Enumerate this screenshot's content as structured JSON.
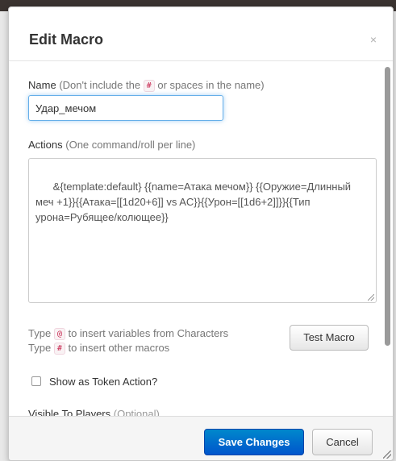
{
  "dialog": {
    "title": "Edit Macro",
    "close_glyph": "×"
  },
  "name_field": {
    "label": "Name",
    "hint_before": "(Don't include the",
    "hint_code": "#",
    "hint_after": "or spaces in the name)",
    "value": "Удар_мечом"
  },
  "actions_field": {
    "label": "Actions",
    "hint": "(One command/roll per line)",
    "value": "&{template:default} {{name=Атака мечом}} {{Оружие=Длинный меч +1}}{{Атака=[[1d20+6]] vs AC}}{{Урон=[[1d6+2]]}}{{Тип урона=Рубящее/колющее}}"
  },
  "help": {
    "line1_prefix": "Type",
    "line1_code": "@",
    "line1_suffix": "to insert variables from Characters",
    "line2_prefix": "Type",
    "line2_code": "#",
    "line2_suffix": "to insert other macros"
  },
  "buttons": {
    "test_macro": "Test Macro",
    "save_changes": "Save Changes",
    "cancel": "Cancel"
  },
  "token_action": {
    "label": "Show as Token Action?",
    "checked": false
  },
  "visible_to_players": {
    "label": "Visible To Players",
    "hint": "(Optional)"
  },
  "icons": {
    "close": "close-icon",
    "resize": "resize-grip-icon"
  },
  "colors": {
    "primary": "#0070cc",
    "code_text": "#c7254e",
    "focus_border": "#66afe9"
  }
}
